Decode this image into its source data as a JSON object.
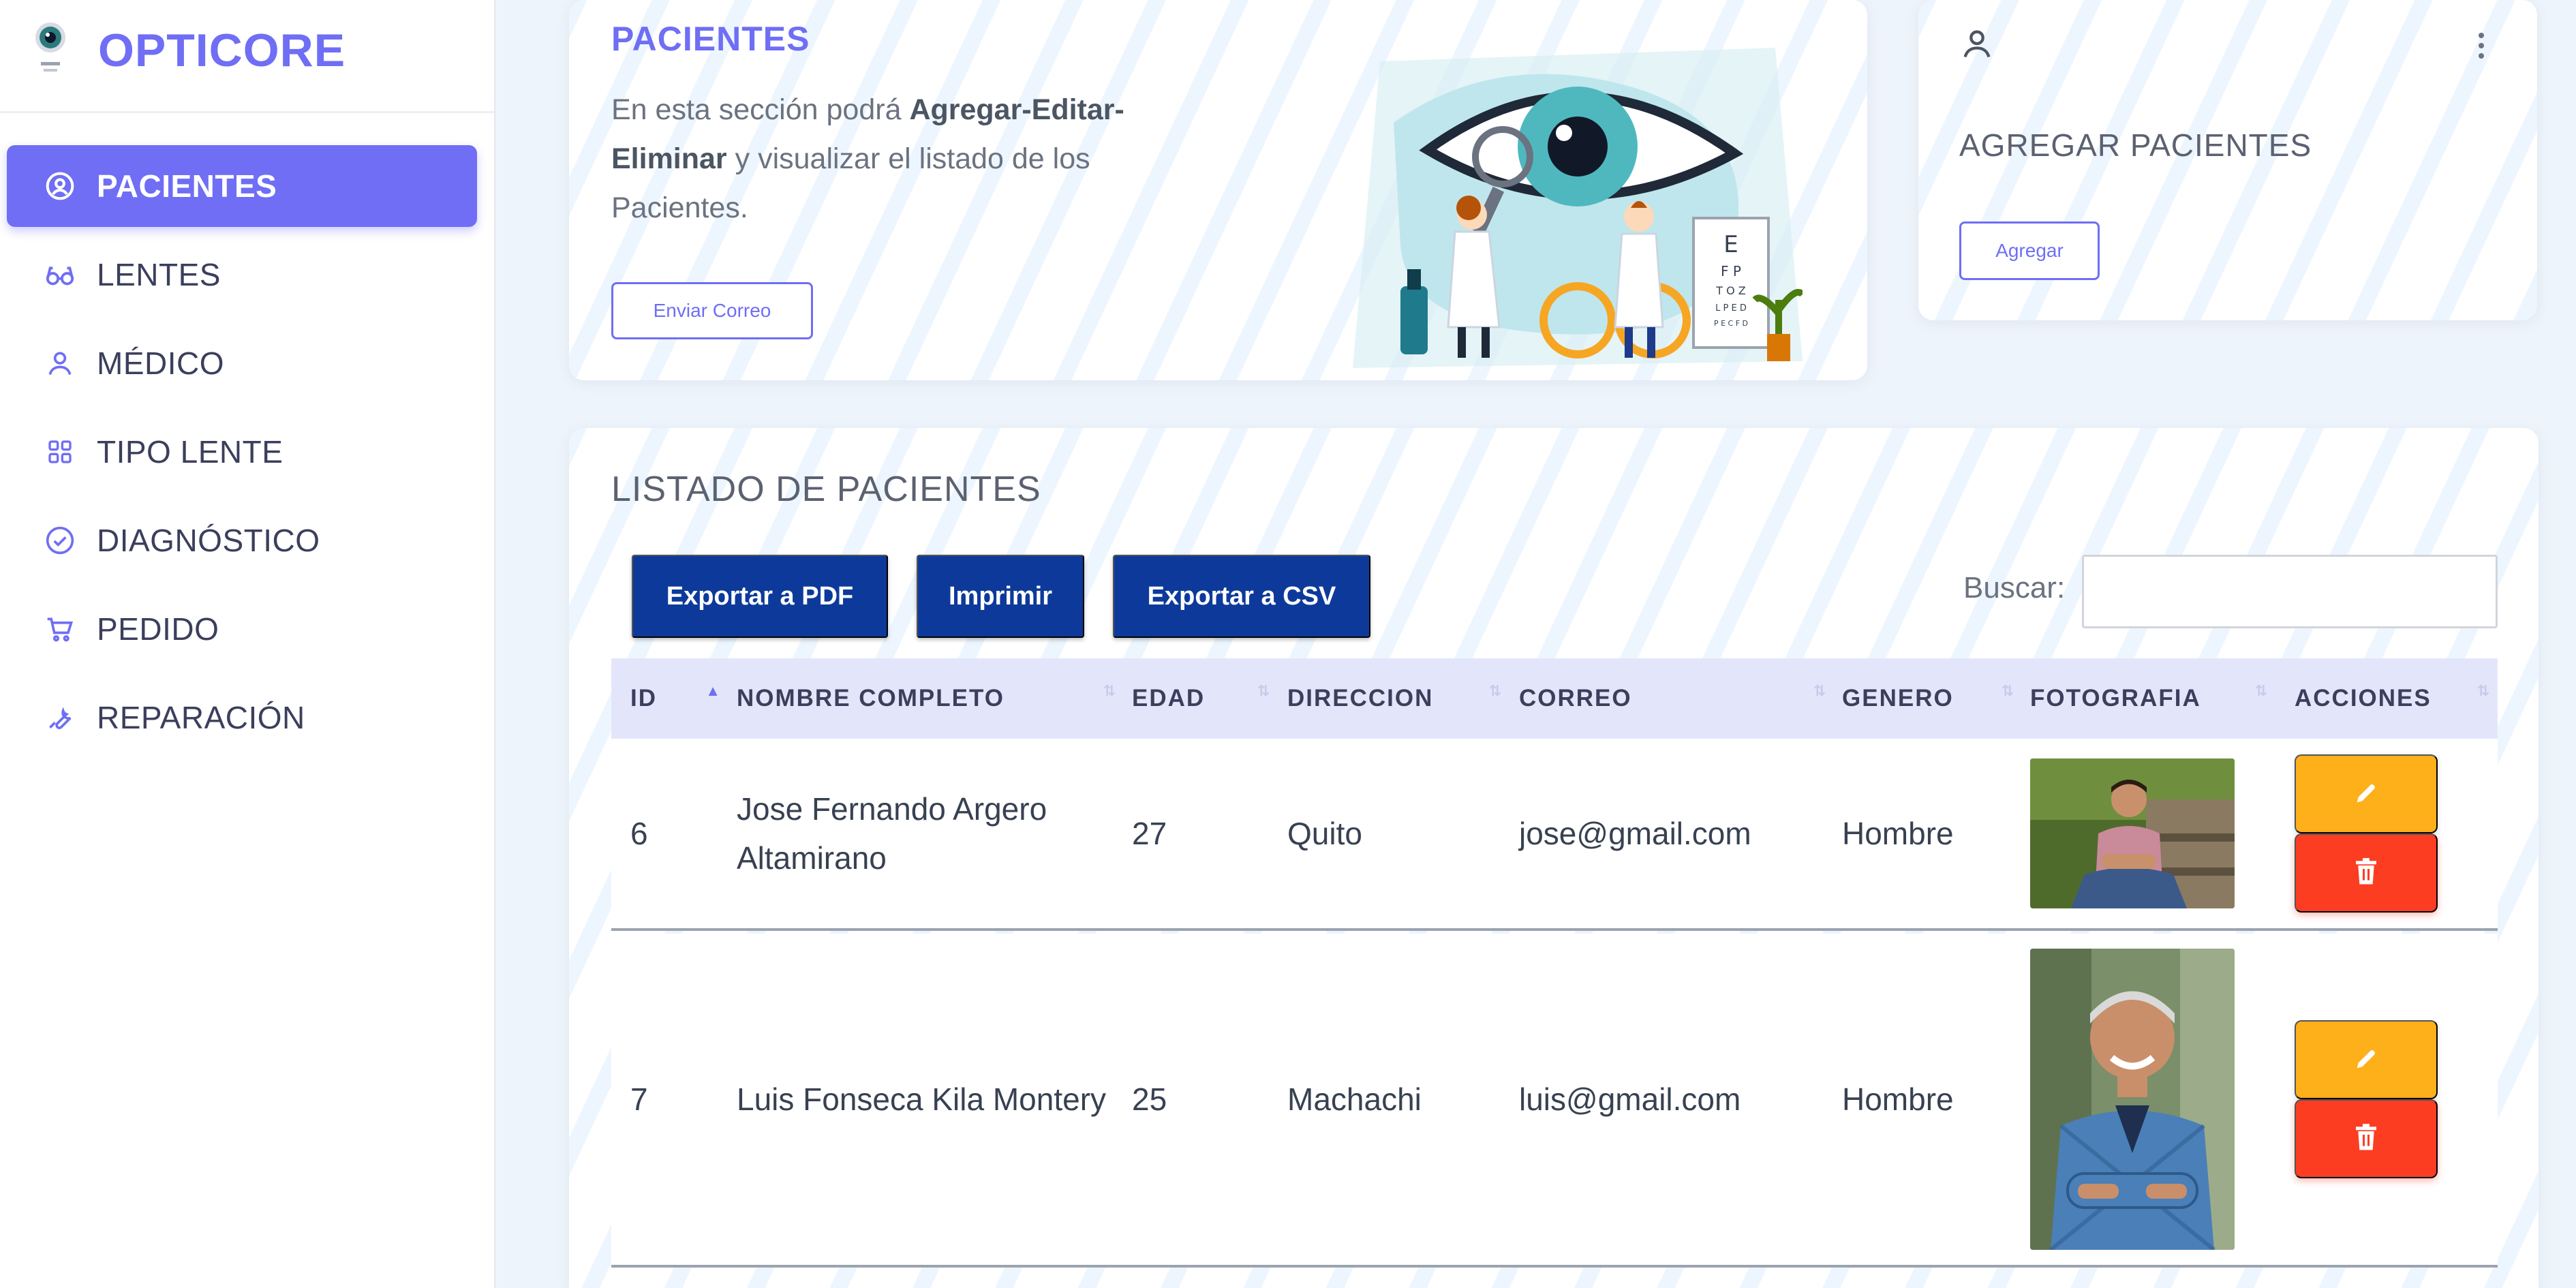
{
  "brand": {
    "name": "OPTICORE",
    "logo_icon": "eye-logo-icon"
  },
  "sidebar": {
    "items": [
      {
        "label": "PACIENTES",
        "icon": "user-circle-icon",
        "active": true
      },
      {
        "label": "LENTES",
        "icon": "glasses-icon",
        "active": false
      },
      {
        "label": "MÉDICO",
        "icon": "user-icon",
        "active": false
      },
      {
        "label": "TIPO LENTE",
        "icon": "grid-icon",
        "active": false
      },
      {
        "label": "DIAGNÓSTICO",
        "icon": "check-circle-icon",
        "active": false
      },
      {
        "label": "PEDIDO",
        "icon": "cart-icon",
        "active": false
      },
      {
        "label": "REPARACIÓN",
        "icon": "wrench-icon",
        "active": false
      }
    ]
  },
  "info_card": {
    "title": "PACIENTES",
    "text_prefix": "En esta sección podrá ",
    "text_bold_1": "Agregar-Editar-Eliminar",
    "text_suffix": " y visualizar el listado de los Pacientes.",
    "mail_button": "Enviar Correo",
    "illustration": "eye-doctors-illustration"
  },
  "add_card": {
    "title": "AGREGAR PACIENTES",
    "add_button": "Agregar",
    "user_icon": "user-icon",
    "menu_icon": "kebab-menu-icon"
  },
  "list": {
    "title": "LISTADO DE PACIENTES",
    "buttons": {
      "pdf": "Exportar a PDF",
      "print": "Imprimir",
      "csv": "Exportar a CSV"
    },
    "search_label": "Buscar:",
    "search_value": "",
    "columns": [
      "ID",
      "NOMBRE COMPLETO",
      "EDAD",
      "DIRECCION",
      "CORREO",
      "GENERO",
      "FOTOGRAFIA",
      "ACCIONES"
    ],
    "rows": [
      {
        "id": "6",
        "name": "Jose Fernando Argero Altamirano",
        "age": "27",
        "address": "Quito",
        "email": "jose@gmail.com",
        "gender": "Hombre",
        "photo": "young-man-sitting-photo"
      },
      {
        "id": "7",
        "name": "Luis Fonseca Kila Montery",
        "age": "25",
        "address": "Machachi",
        "email": "luis@gmail.com",
        "gender": "Hombre",
        "photo": "older-man-smiling-photo"
      }
    ],
    "colors": {
      "header_bg": "#e3e6fb",
      "edit": "#fdb01a",
      "delete": "#fc3d22",
      "export": "#0d3a9a",
      "accent": "#6f6ef5"
    }
  }
}
